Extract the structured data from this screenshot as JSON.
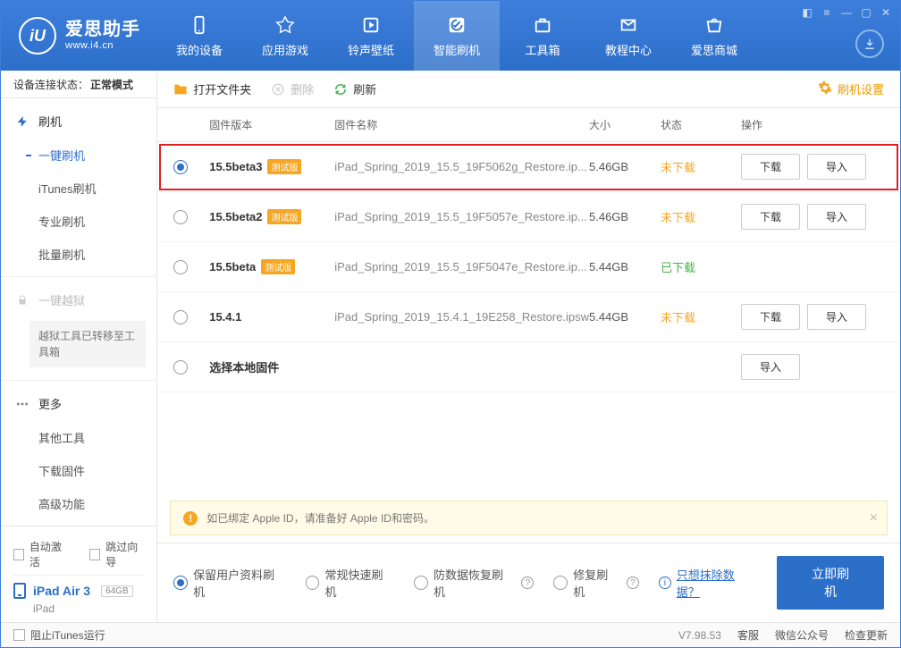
{
  "app": {
    "logo_initials": "iU",
    "name": "爱思助手",
    "domain": "www.i4.cn"
  },
  "nav": {
    "items": [
      {
        "id": "device",
        "label": "我的设备"
      },
      {
        "id": "apps",
        "label": "应用游戏"
      },
      {
        "id": "ringtones",
        "label": "铃声壁纸"
      },
      {
        "id": "flash",
        "label": "智能刷机"
      },
      {
        "id": "tools",
        "label": "工具箱"
      },
      {
        "id": "tutorial",
        "label": "教程中心"
      },
      {
        "id": "store",
        "label": "爱思商城"
      }
    ],
    "active": "flash"
  },
  "sidebar": {
    "conn_label": "设备连接状态：",
    "conn_value": "正常模式",
    "group_flash": {
      "head": "刷机",
      "items": [
        "一键刷机",
        "iTunes刷机",
        "专业刷机",
        "批量刷机"
      ],
      "active_index": 0
    },
    "group_jailbreak": {
      "head": "一键越狱",
      "note": "越狱工具已转移至工具箱"
    },
    "group_more": {
      "head": "更多",
      "items": [
        "其他工具",
        "下载固件",
        "高级功能"
      ]
    },
    "auto_activate": "自动激活",
    "skip_guide": "跳过向导",
    "device": {
      "name": "iPad Air 3",
      "capacity": "64GB",
      "type": "iPad"
    }
  },
  "toolbar": {
    "open_folder": "打开文件夹",
    "delete": "删除",
    "refresh": "刷新",
    "settings": "刷机设置"
  },
  "table": {
    "headers": {
      "version": "固件版本",
      "name": "固件名称",
      "size": "大小",
      "status": "状态",
      "action": "操作"
    },
    "rows": [
      {
        "selected": true,
        "version": "15.5beta3",
        "beta": true,
        "name": "iPad_Spring_2019_15.5_19F5062g_Restore.ip...",
        "size": "5.46GB",
        "status": "未下载",
        "status_class": "st-orange",
        "download": true,
        "import": true,
        "highlight": true
      },
      {
        "selected": false,
        "version": "15.5beta2",
        "beta": true,
        "name": "iPad_Spring_2019_15.5_19F5057e_Restore.ip...",
        "size": "5.46GB",
        "status": "未下载",
        "status_class": "st-orange",
        "download": true,
        "import": true
      },
      {
        "selected": false,
        "version": "15.5beta",
        "beta": true,
        "name": "iPad_Spring_2019_15.5_19F5047e_Restore.ip...",
        "size": "5.44GB",
        "status": "已下载",
        "status_class": "st-green",
        "download": false,
        "import": false
      },
      {
        "selected": false,
        "version": "15.4.1",
        "beta": false,
        "name": "iPad_Spring_2019_15.4.1_19E258_Restore.ipsw",
        "size": "5.44GB",
        "status": "未下载",
        "status_class": "st-orange",
        "download": true,
        "import": true
      },
      {
        "selected": false,
        "version": "选择本地固件",
        "beta": false,
        "name": "",
        "size": "",
        "status": "",
        "status_class": "",
        "download": false,
        "import": true,
        "local": true
      }
    ],
    "beta_label": "测试版",
    "btn_download": "下载",
    "btn_import": "导入"
  },
  "alert": {
    "text": "如已绑定 Apple ID，请准备好 Apple ID和密码。"
  },
  "flash_opts": {
    "opts": [
      {
        "label": "保留用户资料刷机",
        "checked": true
      },
      {
        "label": "常规快速刷机",
        "checked": false
      },
      {
        "label": "防数据恢复刷机",
        "checked": false,
        "help": true
      },
      {
        "label": "修复刷机",
        "checked": false,
        "help": true
      }
    ],
    "erase_link": "只想抹除数据？",
    "action": "立即刷机"
  },
  "footer": {
    "block_itunes": "阻止iTunes运行",
    "version": "V7.98.53",
    "items": [
      "客服",
      "微信公众号",
      "检查更新"
    ]
  }
}
